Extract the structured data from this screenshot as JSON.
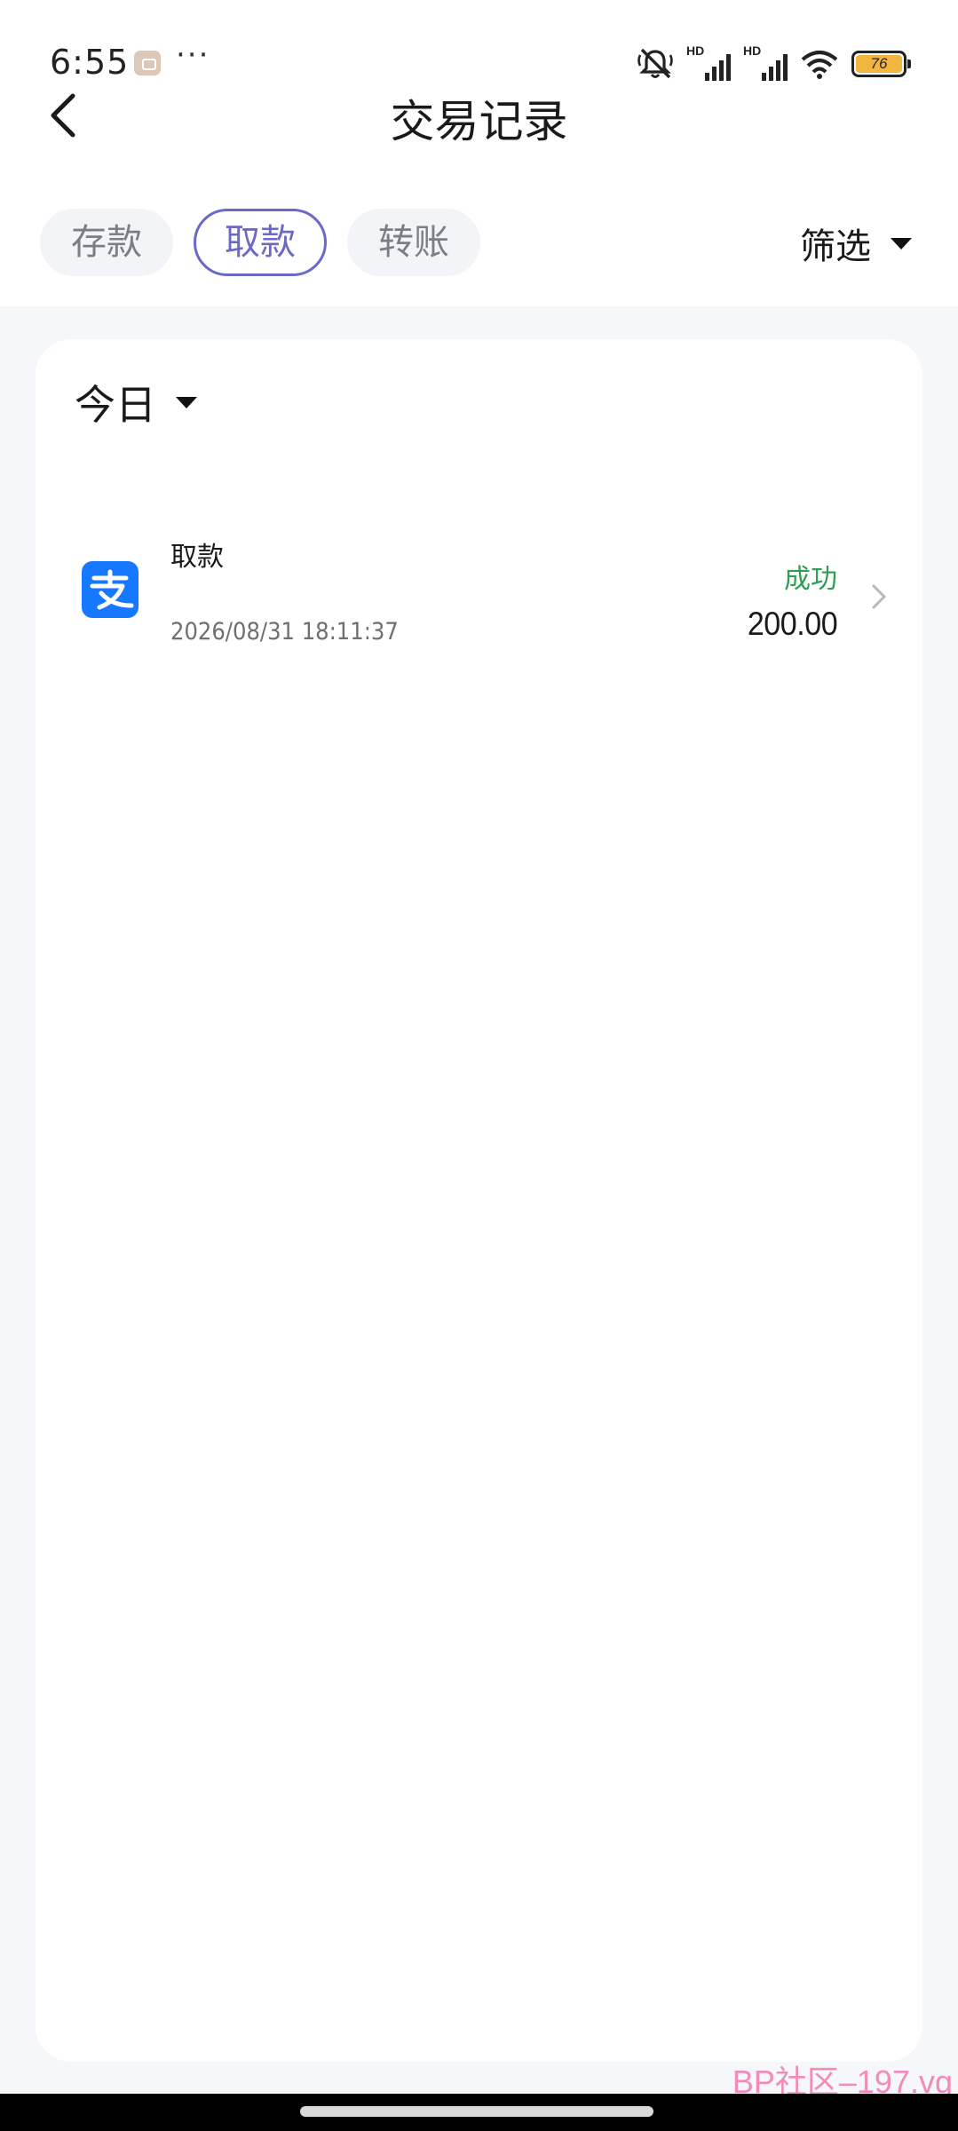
{
  "status_bar": {
    "time": "6:55",
    "more": "···",
    "battery_level": "76",
    "signal_1_label": "HD",
    "signal_2_label": "HD"
  },
  "header": {
    "title": "交易记录"
  },
  "tabs": [
    {
      "label": "存款",
      "active": false
    },
    {
      "label": "取款",
      "active": true
    },
    {
      "label": "转账",
      "active": false
    }
  ],
  "filter": {
    "label": "筛选"
  },
  "date_filter": {
    "label": "今日"
  },
  "transactions": [
    {
      "title": "取款",
      "time": "2026/08/31 18:11:37",
      "status": "成功",
      "amount": "200.00",
      "icon": "alipay-icon"
    }
  ],
  "colors": {
    "accent": "#6b68c9",
    "success": "#2e9e54",
    "alipay_blue": "#1677ff",
    "watermark": "#f28bb8"
  },
  "watermark": "BP社区–197.vg"
}
